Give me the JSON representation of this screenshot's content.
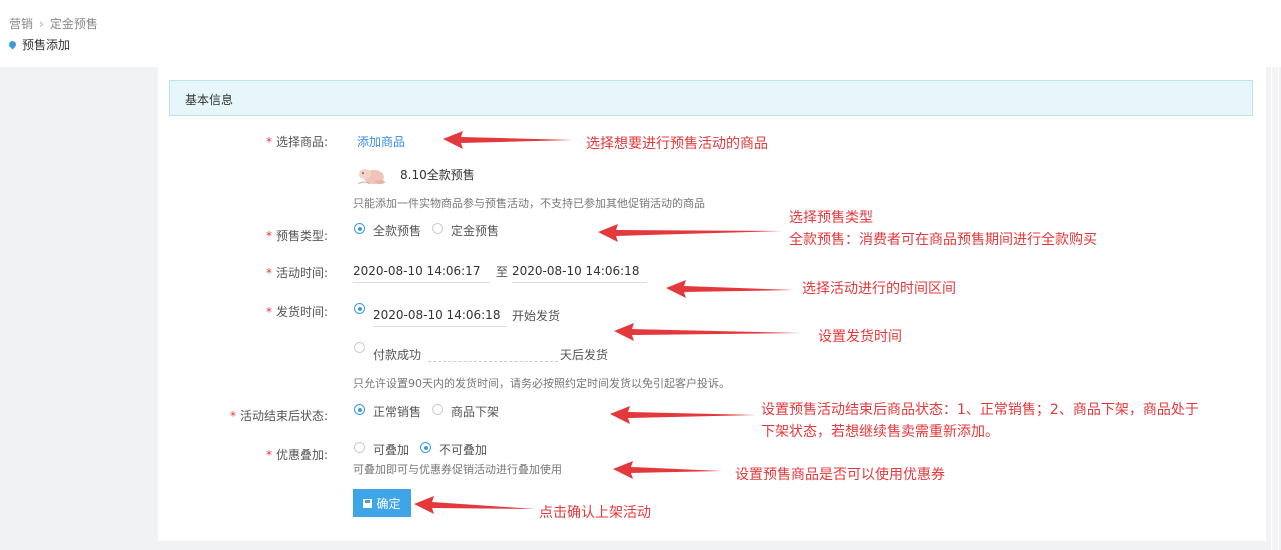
{
  "breadcrumb": {
    "root": "营销",
    "child": "定金预售"
  },
  "page_title": "预售添加",
  "section_title": "基本信息",
  "form": {
    "product": {
      "label": "选择商品:",
      "add_link": "添加商品",
      "item_name": "8.10全款预售",
      "hint": "只能添加一件实物商品参与预售活动，不支持已参加其他促销活动的商品"
    },
    "presale_type": {
      "label": "预售类型:",
      "options": [
        "全款预售",
        "定金预售"
      ],
      "selected": "全款预售"
    },
    "activity_time": {
      "label": "活动时间:",
      "start": "2020-08-10 14:06:17",
      "to": "至",
      "end": "2020-08-10 14:06:18"
    },
    "ship_time": {
      "label": "发货时间:",
      "date": "2020-08-10 14:06:18",
      "date_suffix": "开始发货",
      "opt2_prefix": "付款成功",
      "opt2_suffix": "天后发货",
      "hint": "只允许设置90天内的发货时间，请务必按照约定时间发货以免引起客户投诉。"
    },
    "after_status": {
      "label": "活动结束后状态:",
      "options": [
        "正常销售",
        "商品下架"
      ],
      "selected": "正常销售"
    },
    "stacking": {
      "label": "优惠叠加:",
      "options": [
        "可叠加",
        "不可叠加"
      ],
      "selected": "不可叠加",
      "hint": "可叠加即可与优惠券促销活动进行叠加使用"
    },
    "submit_label": "确定"
  },
  "annotations": {
    "a1": "选择想要进行预售活动的商品",
    "a2_line1": "选择预售类型",
    "a2_line2": "全款预售：消费者可在商品预售期间进行全款购买",
    "a3": "选择活动进行的时间区间",
    "a4": "设置发货时间",
    "a5_line1": "设置预售活动结束后商品状态：1、正常销售；2、商品下架，商品处于",
    "a5_line2": "下架状态，若想继续售卖需重新添加。",
    "a6": "设置预售商品是否可以使用优惠券",
    "a7": "点击确认上架活动"
  },
  "colors": {
    "accent": "#3a9bd6",
    "button": "#3ea6e8",
    "annotation": "#e4393c",
    "section_bg": "#e6f6fa"
  }
}
